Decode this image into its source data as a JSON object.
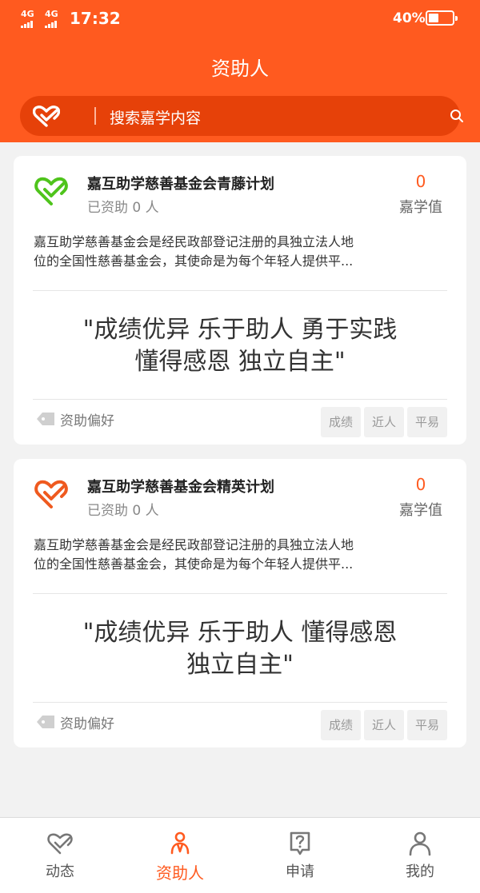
{
  "status_bar": {
    "signal1": "4G",
    "signal2": "4G",
    "time": "17:32",
    "battery": "40%"
  },
  "header": {
    "title": "资助人",
    "search_placeholder": "搜索嘉学内容"
  },
  "cards": [
    {
      "name": "嘉互助学慈善基金会青藤计划",
      "funded": "已资助 0 人",
      "score": "0",
      "score_label": "嘉学值",
      "desc_line1": "嘉互助学慈善基金会是经民政部登记注册的具独立法人地",
      "desc_line2": "位的全国性慈善基金会，其使命是为每个年轻人提供平...",
      "motto_line1": "\"成绩优异 乐于助人 勇于实践",
      "motto_line2": "懂得感恩  独立自主\"",
      "pref_label": "资助偏好",
      "tags": [
        "成绩",
        "近人",
        "平易"
      ],
      "icon_color": "#4fc41c"
    },
    {
      "name": "嘉互助学慈善基金会精英计划",
      "funded": "已资助 0 人",
      "score": "0",
      "score_label": "嘉学值",
      "desc_line1": "嘉互助学慈善基金会是经民政部登记注册的具独立法人地",
      "desc_line2": "位的全国性慈善基金会，其使命是为每个年轻人提供平...",
      "motto_line1": "\"成绩优异 乐于助人 懂得感恩",
      "motto_line2": "独立自主\"",
      "pref_label": "资助偏好",
      "tags": [
        "成绩",
        "近人",
        "平易"
      ],
      "icon_color": "#ef5a1f"
    }
  ],
  "tabbar": {
    "tabs": [
      {
        "label": "动态",
        "icon": "heart-check-icon"
      },
      {
        "label": "资助人",
        "icon": "people-icon"
      },
      {
        "label": "申请",
        "icon": "question-bubble-icon"
      },
      {
        "label": "我的",
        "icon": "user-icon"
      }
    ],
    "active_index": 1
  },
  "colors": {
    "brand": "#ff5a1f",
    "search_bg": "#e64109"
  }
}
